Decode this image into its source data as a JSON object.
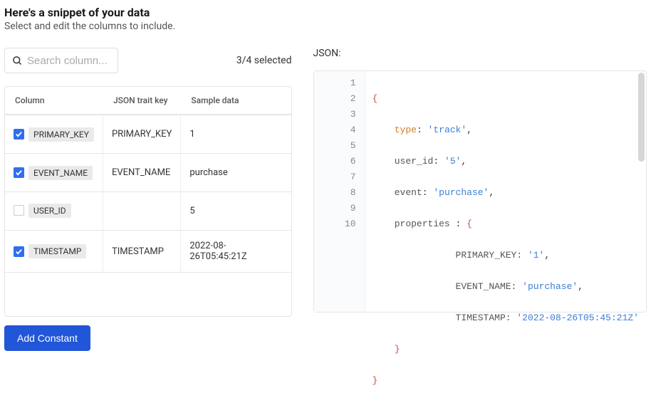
{
  "header": {
    "title": "Here's a snippet of your data",
    "subtitle": "Select and edit the columns to include."
  },
  "search": {
    "placeholder": "Search column..."
  },
  "selection": {
    "text": "3/4 selected"
  },
  "table": {
    "headers": {
      "col": "Column",
      "trait": "JSON trait key",
      "sample": "Sample data"
    },
    "rows": [
      {
        "checked": true,
        "column": "PRIMARY_KEY",
        "trait": "PRIMARY_KEY",
        "sample": "1"
      },
      {
        "checked": true,
        "column": "EVENT_NAME",
        "trait": "EVENT_NAME",
        "sample": "purchase"
      },
      {
        "checked": false,
        "column": "USER_ID",
        "trait": "",
        "sample": "5"
      },
      {
        "checked": true,
        "column": "TIMESTAMP",
        "trait": "TIMESTAMP",
        "sample": "2022-08-26T05:45:21Z"
      }
    ]
  },
  "buttons": {
    "add_constant": "Add Constant"
  },
  "json": {
    "label": "JSON:",
    "nums": [
      "1",
      "2",
      "3",
      "4",
      "5",
      "6",
      "7",
      "8",
      "9",
      "10"
    ],
    "code": {
      "l1_open": "{",
      "l2k": "type",
      "l2c": ": ",
      "l2v": "'track'",
      "l2e": ",",
      "l3k": "user_id",
      "l3c": ": ",
      "l3v": "'5'",
      "l3e": ",",
      "l4k": "event",
      "l4c": ": ",
      "l4v": "'purchase'",
      "l4e": ",",
      "l5k": "properties ",
      "l5c": ": ",
      "l5o": "{",
      "l6k": "PRIMARY_KEY: ",
      "l6v": "'1'",
      "l6e": ",",
      "l7k": "EVENT_NAME: ",
      "l7v": "'purchase'",
      "l7e": ",",
      "l8k": "TIMESTAMP: ",
      "l8v": "'2022-08-26T05:45:21Z'",
      "l9_close": "}",
      "l10_close": "}"
    }
  }
}
